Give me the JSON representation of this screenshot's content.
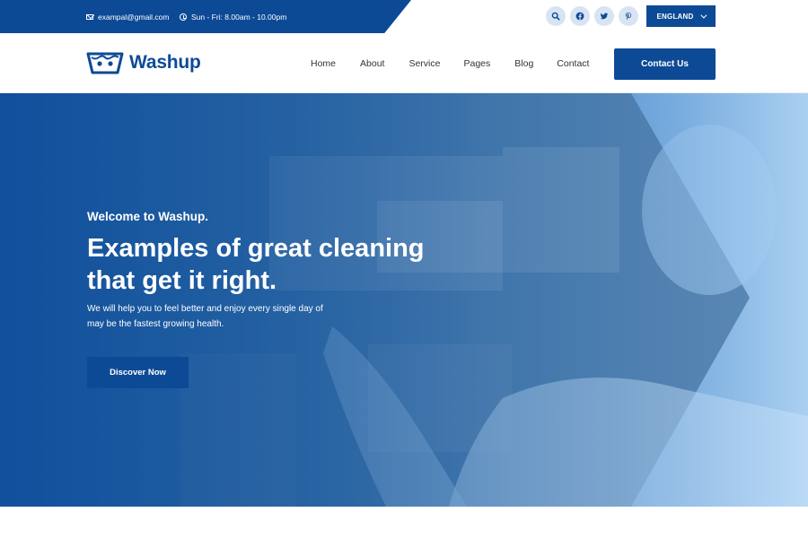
{
  "topbar": {
    "email": "exampal@gmail.com",
    "hours": "Sun - Fri: 8.00am - 10.00pm",
    "socials": [
      {
        "icon": "search-icon"
      },
      {
        "icon": "facebook-icon"
      },
      {
        "icon": "twitter-icon"
      },
      {
        "icon": "pinterest-icon"
      }
    ],
    "language": "ENGLAND"
  },
  "header": {
    "logo_text": "Washup",
    "nav": [
      "Home",
      "About",
      "Service",
      "Pages",
      "Blog",
      "Contact"
    ],
    "cta": "Contact Us"
  },
  "hero": {
    "welcome": "Welcome to Washup.",
    "headline_line1": "Examples of great cleaning",
    "headline_line2": "that get it right.",
    "desc_line1": "We will help you to feel better and enjoy every single day of",
    "desc_line2": "may be the fastest growing health.",
    "button": "Discover Now"
  },
  "colors": {
    "brand": "#0d4a96",
    "social_bg": "#d8e4f3"
  }
}
